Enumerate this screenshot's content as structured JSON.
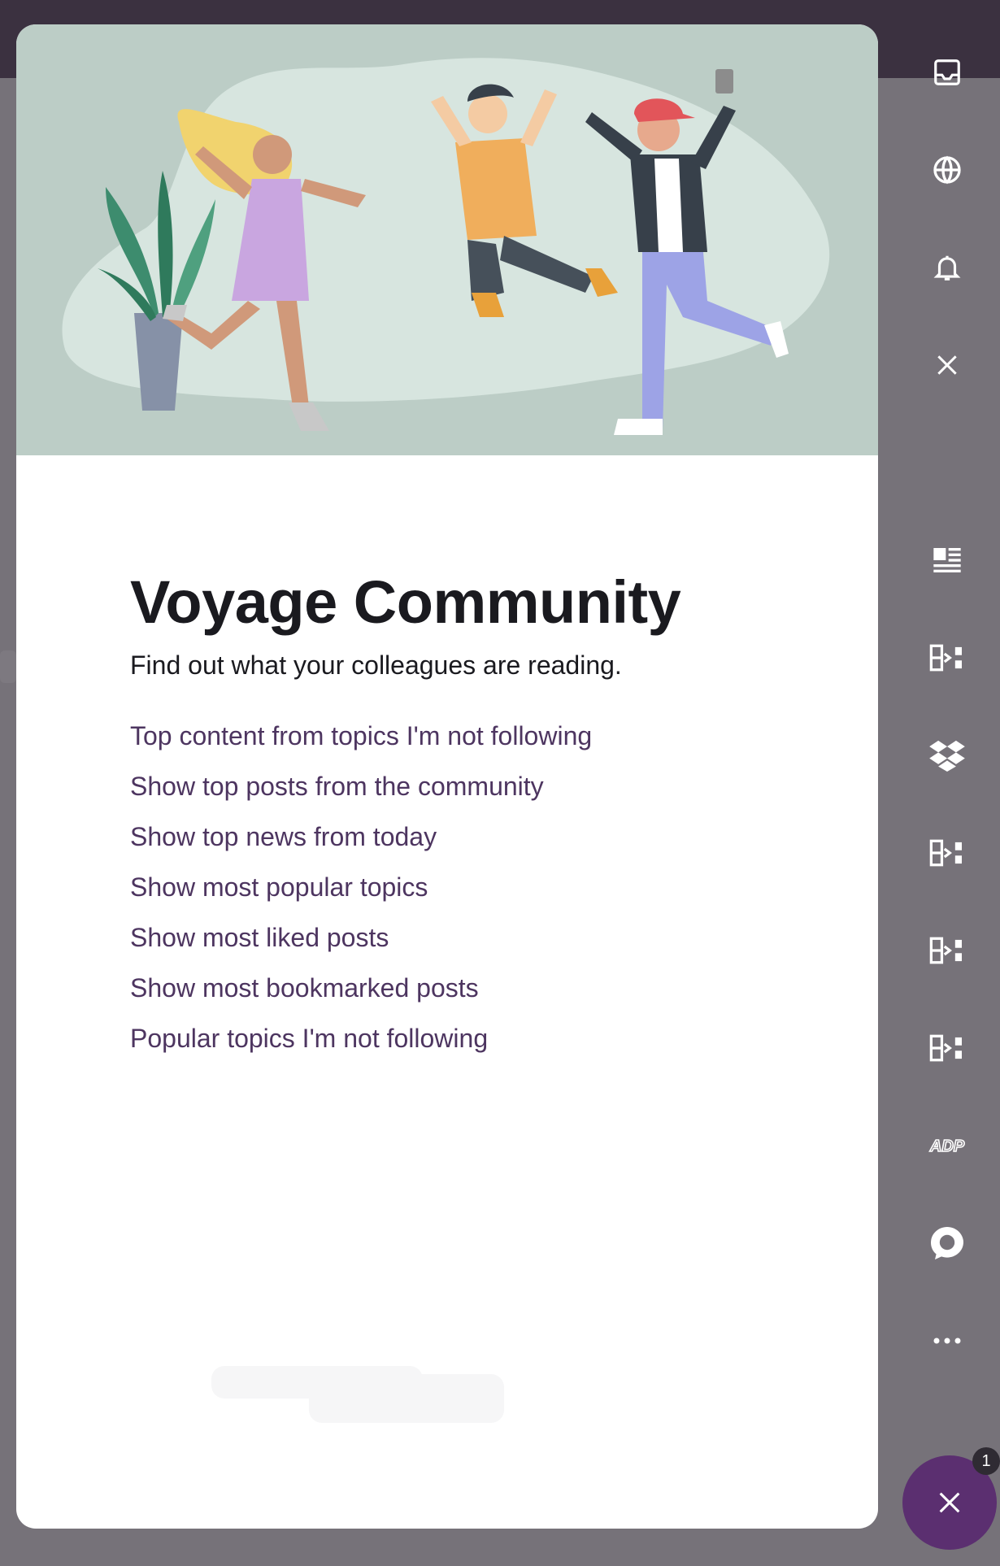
{
  "app": {
    "title": "Voyage Community"
  },
  "card": {
    "title": "Voyage Community",
    "subtitle": "Find out what your colleagues are reading.",
    "links": [
      "Top content from topics I'm not following",
      "Show top posts from the community",
      "Show top news from today",
      "Show most popular topics",
      "Show most liked posts",
      "Show most bookmarked posts",
      "Popular topics I'm not following"
    ]
  },
  "rail": {
    "icons": [
      "inbox-icon",
      "globe-icon",
      "bell-icon",
      "close-icon",
      "feed-list-icon",
      "integration-icon",
      "dropbox-icon",
      "integration-icon",
      "integration-icon",
      "integration-icon",
      "adp-icon",
      "chat-bubble-icon",
      "more-icon"
    ],
    "adp_label": "ADP"
  },
  "fab": {
    "badge_count": "1",
    "icon": "close-icon"
  },
  "colors": {
    "accent": "#5b2f70",
    "link": "#4d3560",
    "hero_bg": "#bccdc6"
  }
}
